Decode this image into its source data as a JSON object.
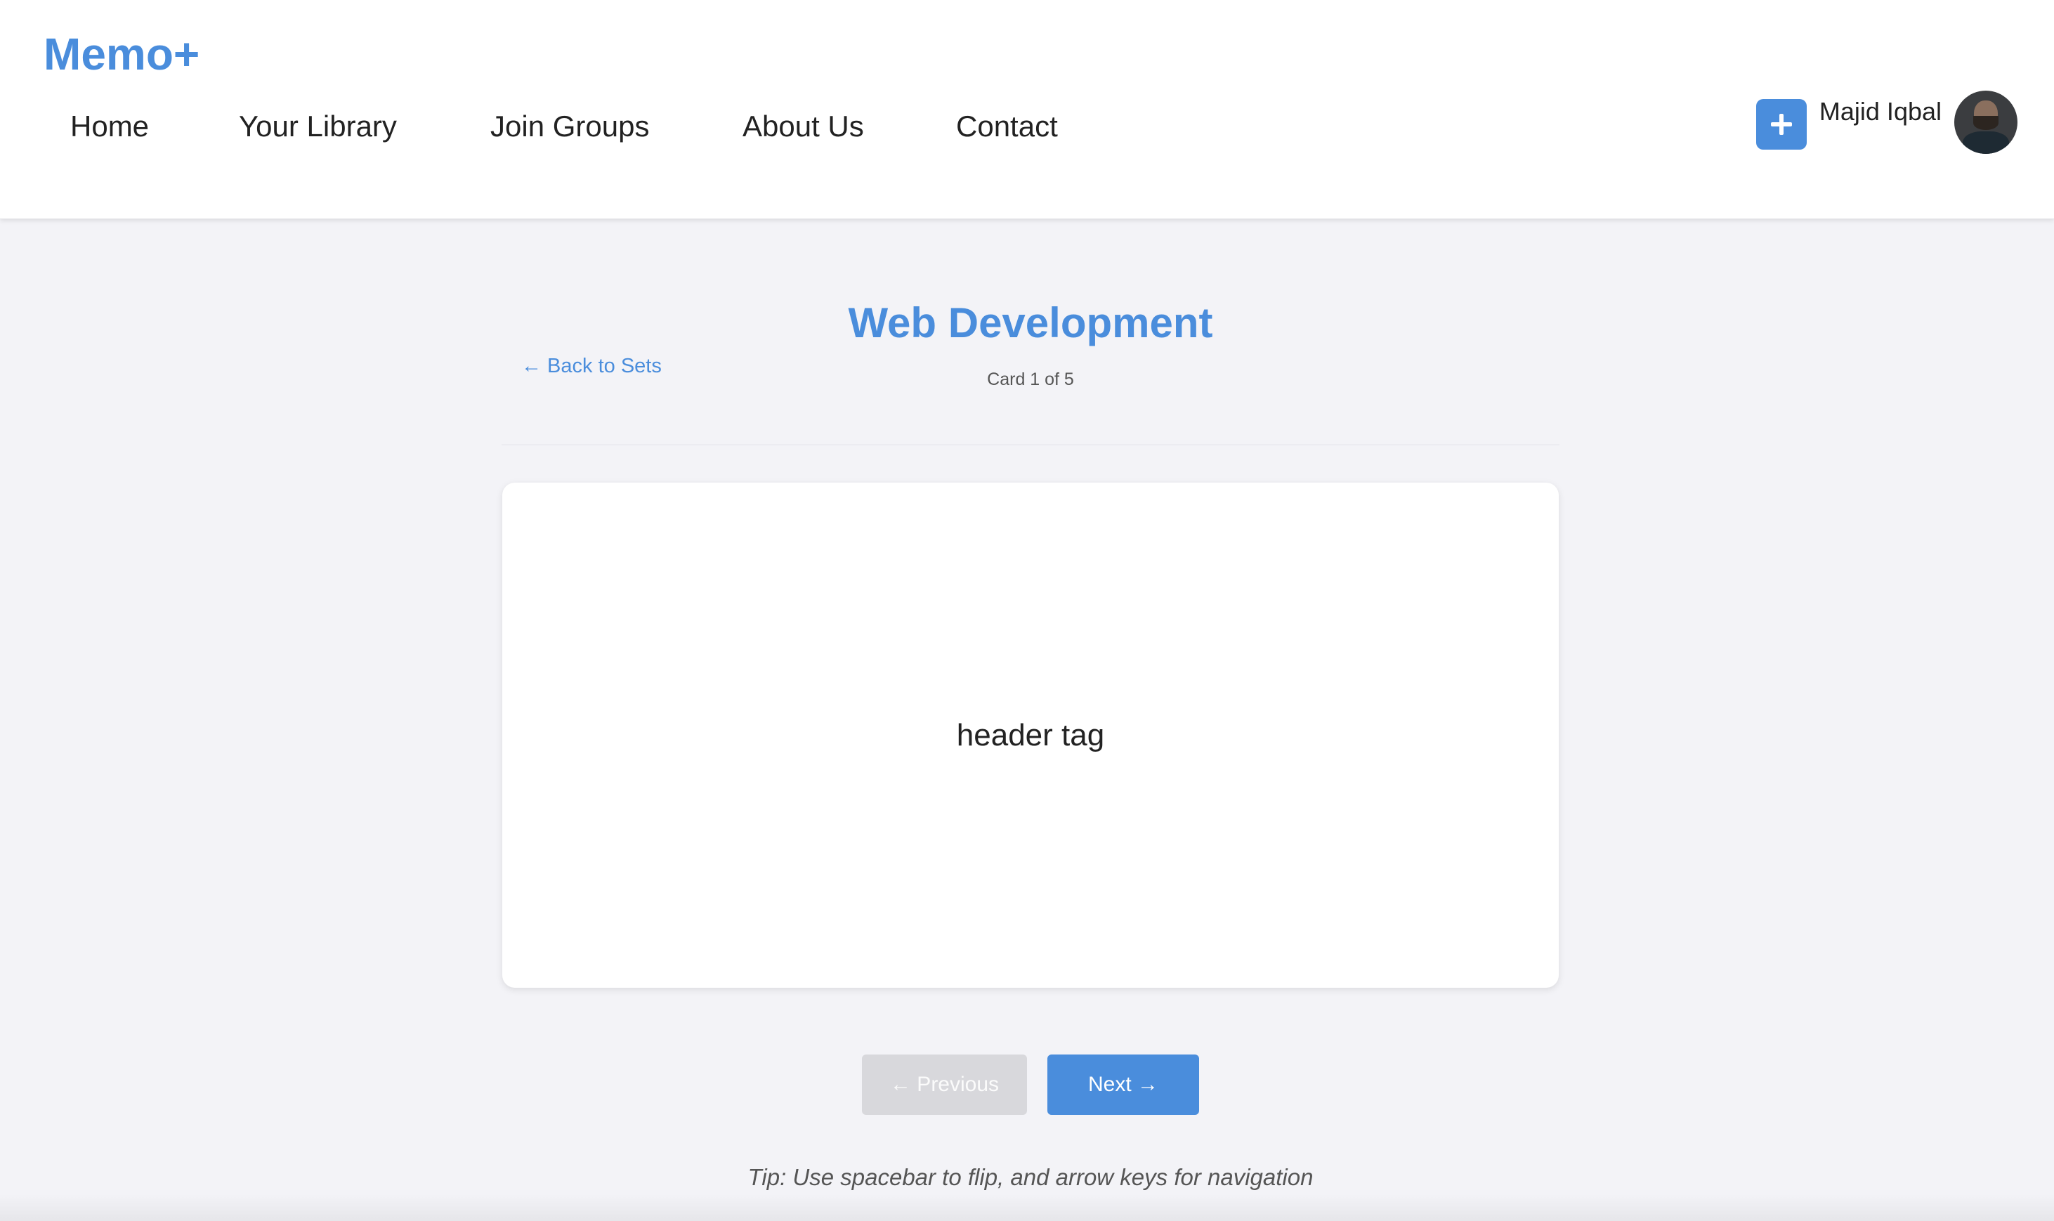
{
  "brand": {
    "logo": "Memo+",
    "accent_color": "#4a8ddc"
  },
  "nav": {
    "items": [
      {
        "label": "Home"
      },
      {
        "label": "Your Library"
      },
      {
        "label": "Join Groups"
      },
      {
        "label": "About Us"
      },
      {
        "label": "Contact"
      }
    ]
  },
  "user": {
    "name": "Majid Iqbal",
    "add_icon": "plus-icon",
    "avatar_icon": "user-avatar"
  },
  "study": {
    "set_title": "Web Development",
    "back_label": "← Back to Sets",
    "counter": "Card 1 of 5",
    "current_card": {
      "index": 1,
      "total": 5
    }
  },
  "card": {
    "text": "header tag"
  },
  "controls": {
    "previous_label": "← Previous",
    "next_label": "Next →",
    "previous_color": "#d8d8dc",
    "next_color": "#4a8ddc"
  },
  "tip": "Tip: Use spacebar to flip, and arrow keys for navigation"
}
